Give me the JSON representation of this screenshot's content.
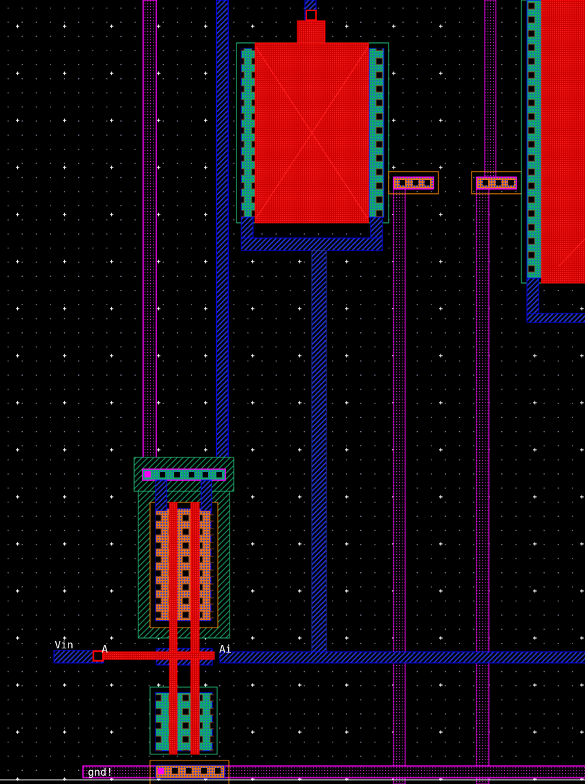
{
  "labels": {
    "vin": "Vin",
    "a": "A",
    "ai": "Ai",
    "gnd": "gnd!"
  },
  "colors": {
    "background": "#000000",
    "poly": "#ff0000",
    "metal1": "#0000ff",
    "metal2": "#ff00ff",
    "diffusion": "#00aa66",
    "pdiff": "#e07020",
    "well_outline": "#22bb77",
    "select_outline": "#ff8800"
  }
}
